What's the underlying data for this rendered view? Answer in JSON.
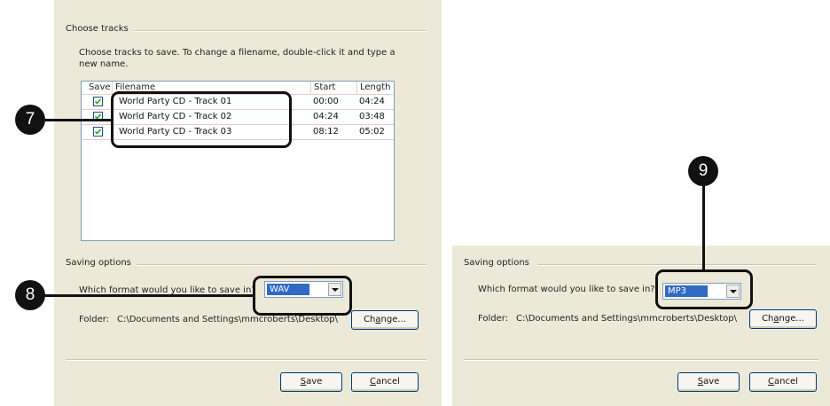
{
  "left_dialog": {
    "choose_tracks": {
      "group_title": "Choose tracks",
      "description": "Choose tracks to save. To change a filename, double-click it and type a new name.",
      "columns": {
        "save": "Save",
        "filename": "Filename",
        "start": "Start",
        "length": "Length"
      },
      "tracks": [
        {
          "checked": true,
          "filename": "World Party CD - Track 01",
          "start": "00:00",
          "length": "04:24"
        },
        {
          "checked": true,
          "filename": "World Party CD - Track 02",
          "start": "04:24",
          "length": "03:48"
        },
        {
          "checked": true,
          "filename": "World Party CD - Track 03",
          "start": "08:12",
          "length": "05:02"
        }
      ]
    },
    "saving_options": {
      "group_title": "Saving options",
      "format_label": "Which format would you like to save in?",
      "format_value": "WAV",
      "folder_label": "Folder:",
      "folder_path": "C:\\Documents and Settings\\mmcroberts\\Desktop\\",
      "change_button": {
        "pre": "Ch",
        "key": "a",
        "post": "nge..."
      }
    },
    "buttons": {
      "save": {
        "key": "S",
        "rest": "ave"
      },
      "cancel": {
        "key": "C",
        "rest": "ancel"
      }
    }
  },
  "right_dialog": {
    "saving_options": {
      "group_title": "Saving options",
      "format_label": "Which format would you like to save in?",
      "format_value": "MP3",
      "folder_label": "Folder:",
      "folder_path": "C:\\Documents and Settings\\mmcroberts\\Desktop\\",
      "change_button": {
        "pre": "Ch",
        "key": "a",
        "post": "nge..."
      }
    },
    "buttons": {
      "save": {
        "key": "S",
        "rest": "ave"
      },
      "cancel": {
        "key": "C",
        "rest": "ancel"
      }
    }
  },
  "callouts": {
    "tracks": "7",
    "format_left": "8",
    "format_right": "9"
  },
  "colors": {
    "callout": "#111111",
    "dialog_bg": "#ece9d8",
    "selection": "#316ac5",
    "checkbox_border": "#1c5180"
  }
}
